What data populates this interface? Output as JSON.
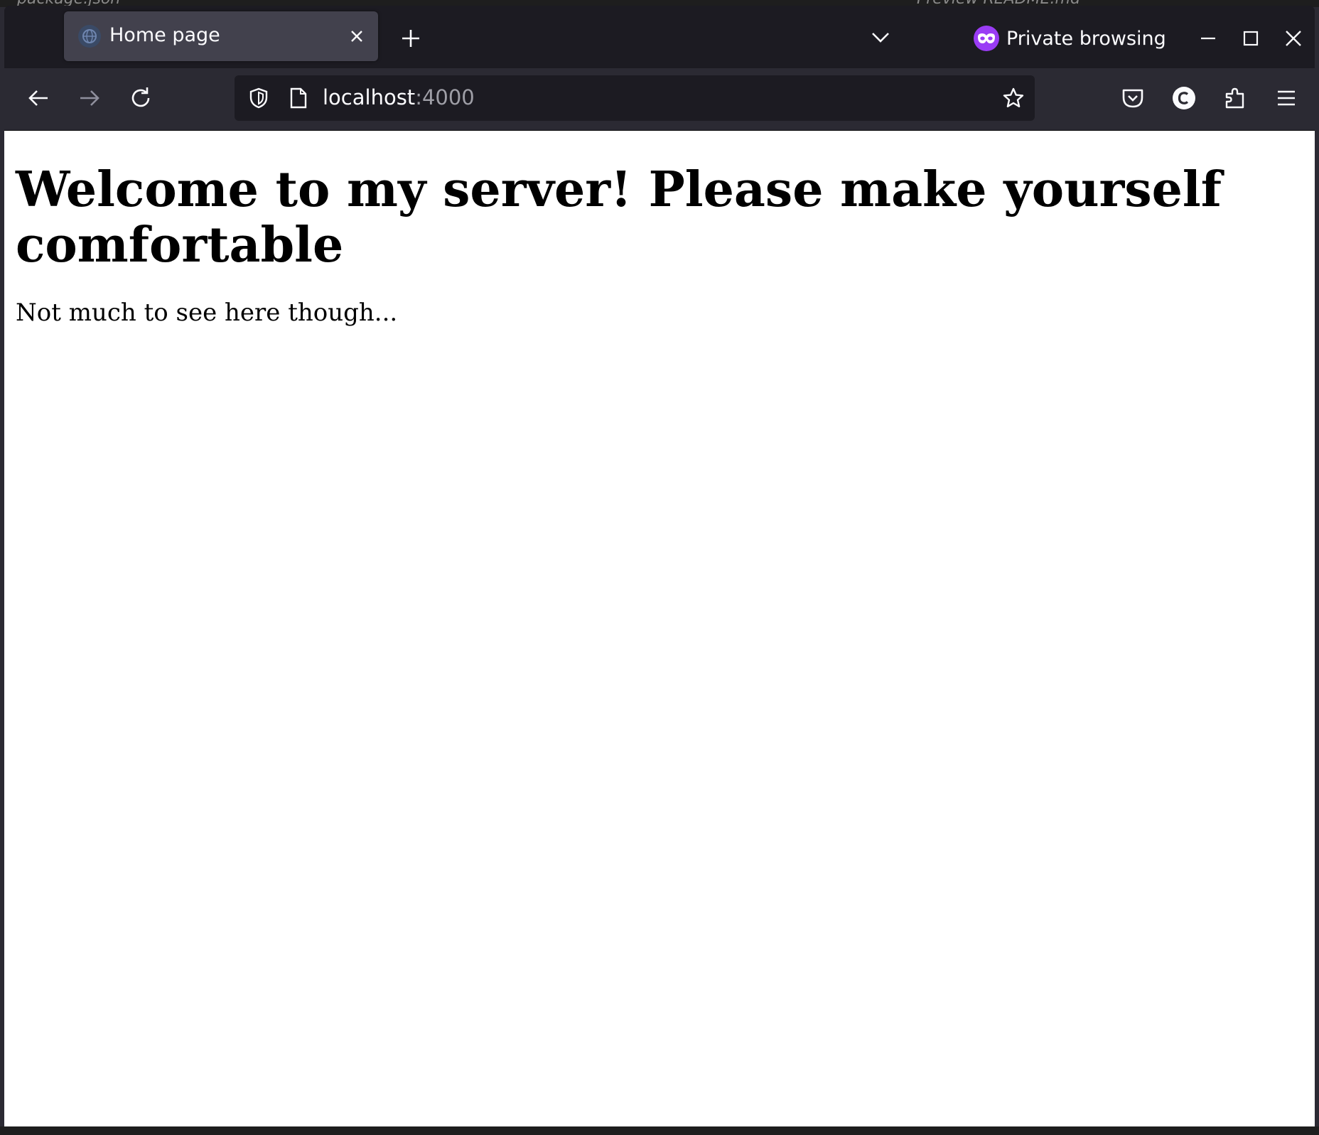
{
  "background_window": {
    "left_tab_label": "package.json",
    "right_tab_label": "Preview README.md"
  },
  "browser": {
    "tab": {
      "title": "Home page",
      "favicon": "globe-icon"
    },
    "private_label": "Private browsing",
    "url": {
      "host": "localhost",
      "port": ":4000"
    },
    "icons": {
      "back": "back-arrow-icon",
      "forward": "forward-arrow-icon",
      "reload": "reload-icon",
      "shield": "shield-icon",
      "page": "page-icon",
      "star": "star-icon",
      "pocket": "pocket-icon",
      "account": "account-icon",
      "extensions": "extensions-icon",
      "menu": "hamburger-menu-icon"
    },
    "colors": {
      "chrome_dark": "#1c1b22",
      "toolbar": "#2b2a33",
      "active_tab": "#42414d",
      "private_accent": "#9a3cf5"
    }
  },
  "page": {
    "heading": "Welcome to my server! Please make yourself comfortable",
    "paragraph": "Not much to see here though..."
  }
}
